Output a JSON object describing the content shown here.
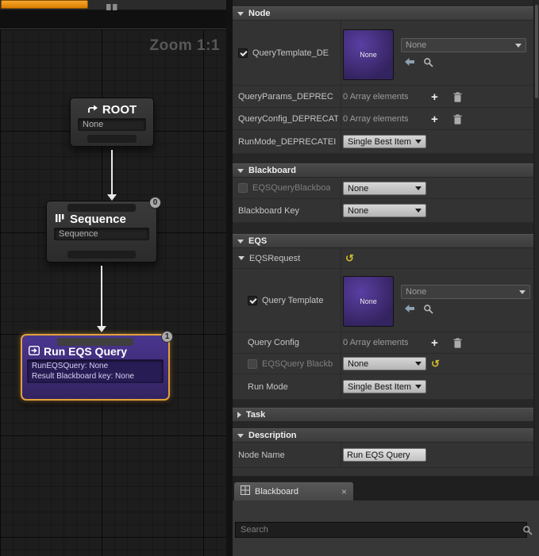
{
  "graph": {
    "zoom_label": "Zoom 1:1",
    "nodes": {
      "root": {
        "title": "ROOT",
        "subtitle": "None"
      },
      "sequence": {
        "title": "Sequence",
        "subtitle": "Sequence",
        "badge": "0"
      },
      "run_eqs": {
        "title": "Run EQS Query",
        "detail1": "RunEQSQuery: None",
        "detail2": "Result Blackboard key: None",
        "badge": "1"
      }
    }
  },
  "details": {
    "sections": {
      "node": {
        "title": "Node",
        "rows": {
          "query_template": {
            "label": "QueryTemplate_DE",
            "thumb_label": "None",
            "dropdown_value": "None"
          },
          "query_params": {
            "label": "QueryParams_DEPREC",
            "value": "0 Array elements"
          },
          "query_config": {
            "label": "QueryConfig_DEPRECAT",
            "value": "0 Array elements"
          },
          "run_mode": {
            "label": "RunMode_DEPRECATEI",
            "value": "Single Best Item"
          }
        }
      },
      "blackboard": {
        "title": "Blackboard",
        "rows": {
          "eqs_query_blackboard": {
            "label": "EQSQueryBlackboa",
            "value": "None"
          },
          "blackboard_key": {
            "label": "Blackboard Key",
            "value": "None"
          }
        }
      },
      "eqs": {
        "title": "EQS",
        "request_label": "EQSRequest",
        "rows": {
          "query_template": {
            "label": "Query Template",
            "thumb_label": "None",
            "dropdown_value": "None"
          },
          "query_config": {
            "label": "Query Config",
            "value": "0 Array elements"
          },
          "eqs_query_blackboard": {
            "label": "EQSQuery Blackb",
            "value": "None"
          },
          "run_mode": {
            "label": "Run Mode",
            "value": "Single Best Item"
          }
        }
      },
      "task": {
        "title": "Task"
      },
      "description": {
        "title": "Description",
        "rows": {
          "node_name": {
            "label": "Node Name",
            "value": "Run EQS Query"
          }
        }
      }
    }
  },
  "bottom_panel": {
    "tab_label": "Blackboard",
    "search_placeholder": "Search"
  },
  "icons": {
    "plus": "+",
    "reset": "↺",
    "close": "×"
  },
  "colors": {
    "selection_orange": "#E2A13D",
    "task_purple": "#3D2B7A"
  }
}
